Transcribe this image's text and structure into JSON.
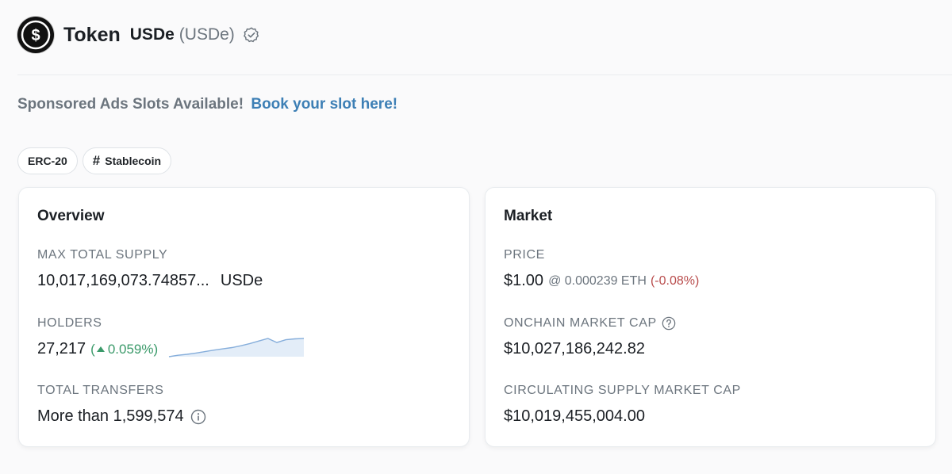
{
  "header": {
    "title": "Token",
    "token_name": "USDe",
    "token_symbol": "(USDe)"
  },
  "ads": {
    "text": "Sponsored Ads Slots Available!",
    "link": "Book your slot here!"
  },
  "badges": [
    {
      "label": "ERC-20",
      "icon": ""
    },
    {
      "label": "Stablecoin",
      "icon": "#"
    }
  ],
  "overview": {
    "title": "Overview",
    "max_supply_label": "MAX TOTAL SUPPLY",
    "max_supply_value": "10,017,169,073.74857...",
    "max_supply_unit": "USDe",
    "holders_label": "HOLDERS",
    "holders_value": "27,217",
    "holders_change_open": "(",
    "holders_change": "0.059%)",
    "holders_trend": [
      0.0,
      0.08,
      0.13,
      0.2,
      0.28,
      0.36,
      0.43,
      0.5,
      0.6,
      0.72,
      0.86,
      1.0,
      0.78,
      0.93,
      0.98,
      1.0
    ],
    "transfers_label": "TOTAL TRANSFERS",
    "transfers_value": "More than 1,599,574"
  },
  "market": {
    "title": "Market",
    "price_label": "PRICE",
    "price_value": "$1.00",
    "price_eth": "@ 0.000239 ETH",
    "price_change": "(-0.08%)",
    "onchain_cap_label": "ONCHAIN MARKET CAP",
    "onchain_cap_value": "$10,027,186,242.82",
    "circ_cap_label": "CIRCULATING SUPPLY MARKET CAP",
    "circ_cap_value": "$10,019,455,004.00"
  },
  "colors": {
    "link": "#3d7fb5",
    "positive": "#3b9a6a",
    "negative": "#b94d4d",
    "sparkline_line": "#86aedb",
    "sparkline_fill": "#e3edf8"
  },
  "icons": {
    "logo": "usde-logo-icon",
    "verified": "verified-check-icon",
    "help": "question-circle-icon",
    "info": "info-circle-icon",
    "up": "caret-up-icon"
  }
}
